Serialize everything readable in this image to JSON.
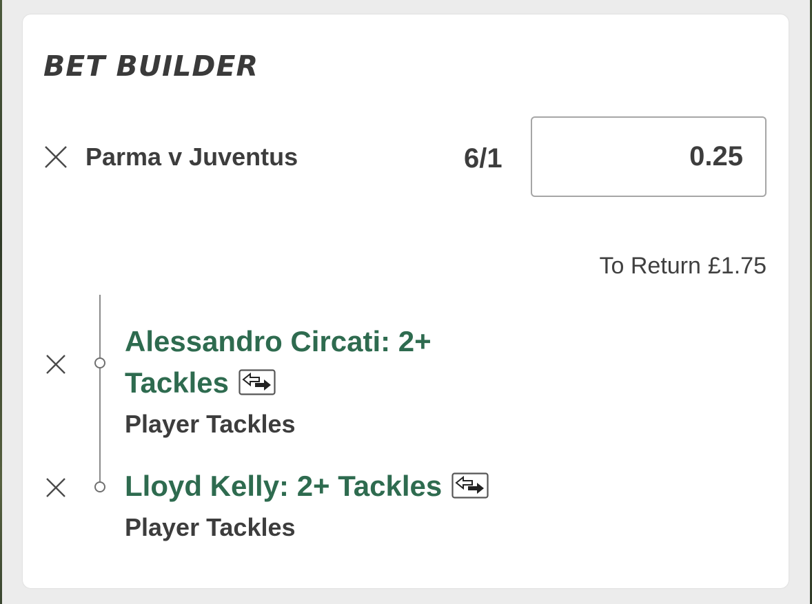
{
  "bet_builder": {
    "title": "BET BUILDER",
    "event": "Parma v Juventus",
    "odds": "6/1",
    "stake": "0.25",
    "to_return_label": "To Return",
    "to_return_value": "£1.75",
    "selections": [
      {
        "name_line1": "Alessandro Circati: 2+",
        "name_line2": "Tackles",
        "market": "Player Tackles"
      },
      {
        "name": "Lloyd Kelly: 2+ Tackles",
        "market": "Player Tackles"
      }
    ]
  },
  "icons": {
    "remove": "close-icon",
    "swap": "swap-icon"
  },
  "colors": {
    "selection_green": "#2e6b4f",
    "text_dark": "#3d3d3d",
    "background": "#ececec"
  }
}
